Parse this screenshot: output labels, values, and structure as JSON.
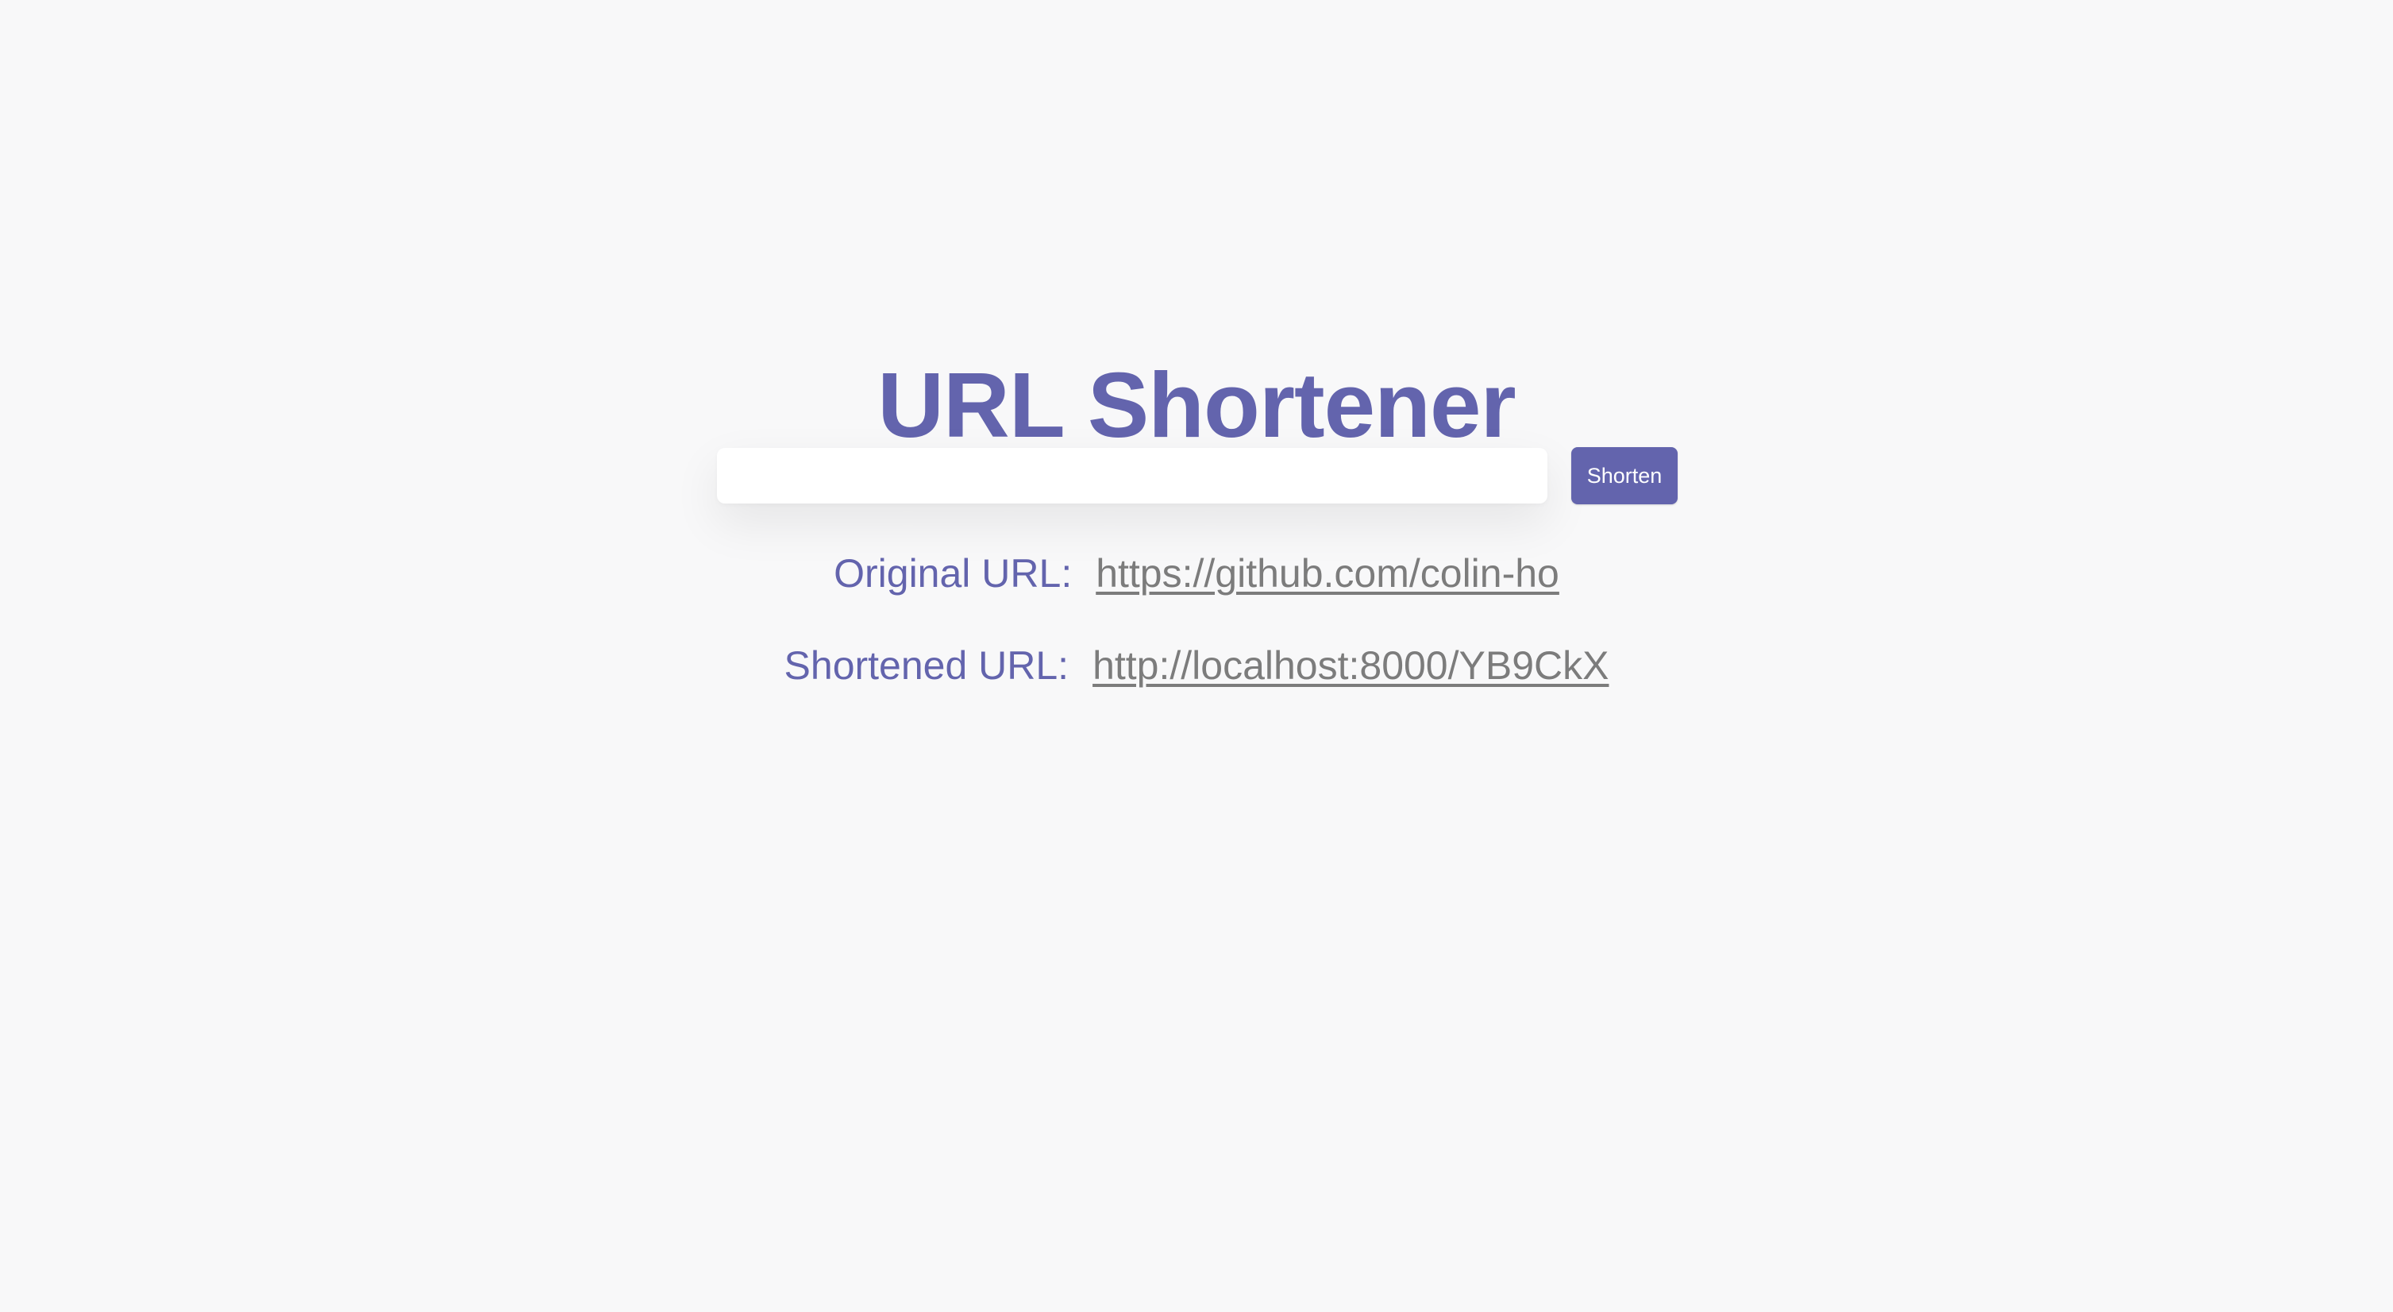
{
  "header": {
    "title": "URL Shortener"
  },
  "form": {
    "input_value": "",
    "input_placeholder": "",
    "shorten_label": "Shorten"
  },
  "results": {
    "original_label": "Original URL:",
    "original_url": "https://github.com/colin-ho",
    "shortened_label": "Shortened URL:",
    "shortened_url": "http://localhost:8000/YB9CkX"
  },
  "colors": {
    "accent": "#6364ad",
    "background": "#f8f8f9",
    "link": "#7c7c7c"
  }
}
